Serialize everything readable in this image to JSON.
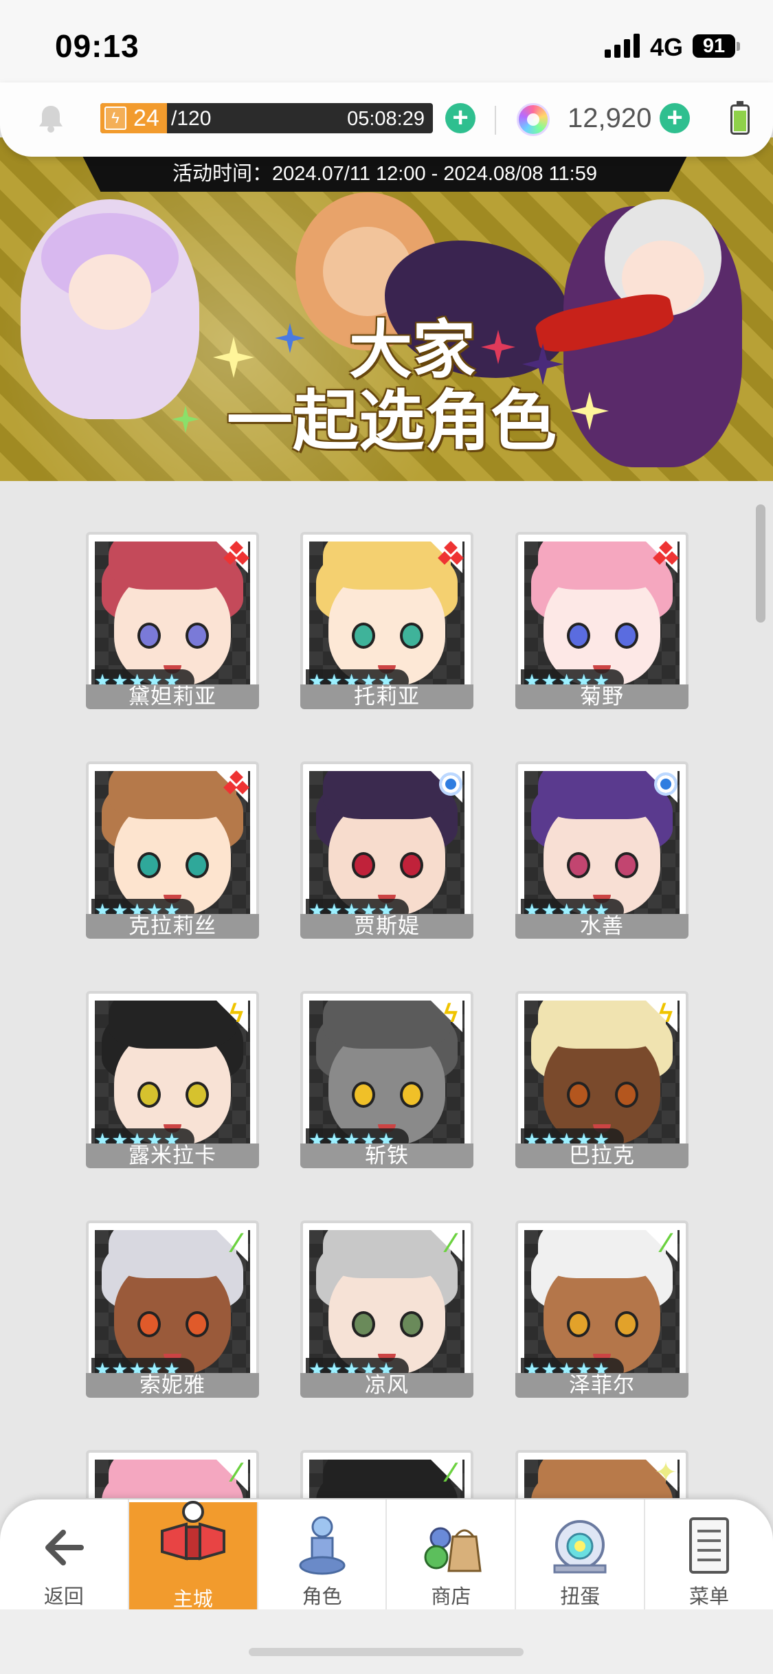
{
  "status_bar": {
    "time": "09:13",
    "network": "4G",
    "battery": "91"
  },
  "resources": {
    "stamina_current": "24",
    "stamina_max": "/120",
    "stamina_fraction": 0.2,
    "stamina_timer": "05:08:29",
    "gems": "12,920"
  },
  "banner": {
    "period": "活动时间：2024.07/11 12:00 - 2024.08/08 11:59",
    "title_line1": "大家",
    "title_line2": "一起选角色"
  },
  "characters": [
    {
      "name": "黛妲莉亚",
      "element": "fire",
      "stars": 5,
      "hair": "#c44a5a",
      "skin": "#fbe3d4",
      "eyes": "#7a7ad8"
    },
    {
      "name": "托莉亚",
      "element": "fire",
      "stars": 5,
      "hair": "#f4d070",
      "skin": "#fde8d6",
      "eyes": "#3fb39a"
    },
    {
      "name": "菊野",
      "element": "fire",
      "stars": 5,
      "hair": "#f5a7bf",
      "skin": "#fde8e6",
      "eyes": "#5a6ce0"
    },
    {
      "name": "克拉莉丝",
      "element": "fire",
      "stars": 5,
      "hair": "#b5794a",
      "skin": "#fde4cf",
      "eyes": "#2fa89a"
    },
    {
      "name": "贾斯媞",
      "element": "water",
      "stars": 5,
      "hair": "#3b2a4f",
      "skin": "#f7dccd",
      "eyes": "#c0223a"
    },
    {
      "name": "水善",
      "element": "water",
      "stars": 5,
      "hair": "#5a3a8e",
      "skin": "#f8dfd4",
      "eyes": "#c24570"
    },
    {
      "name": "露米拉卡",
      "element": "light",
      "stars": 5,
      "hair": "#232323",
      "skin": "#f8e2d5",
      "eyes": "#d6c22e"
    },
    {
      "name": "斩铁",
      "element": "light",
      "stars": 5,
      "hair": "#5b5b5b",
      "skin": "#8a8a8a",
      "eyes": "#f0c028"
    },
    {
      "name": "巴拉克",
      "element": "light",
      "stars": 5,
      "hair": "#f0e3b0",
      "skin": "#7a4a2c",
      "eyes": "#b4561e"
    },
    {
      "name": "索妮雅",
      "element": "wind",
      "stars": 5,
      "hair": "#d8d8e0",
      "skin": "#9a5a3a",
      "eyes": "#e05a2a"
    },
    {
      "name": "凉风",
      "element": "wind",
      "stars": 5,
      "hair": "#c8c8c8",
      "skin": "#f6e2d6",
      "eyes": "#6a8a5a"
    },
    {
      "name": "泽菲尔",
      "element": "wind",
      "stars": 5,
      "hair": "#f0f0f0",
      "skin": "#b4764a",
      "eyes": "#e2a22a"
    },
    {
      "name": "",
      "element": "wind",
      "stars": 5,
      "hair": "#f4a7c0",
      "skin": "#fde8e6",
      "eyes": "#5a6ce0"
    },
    {
      "name": "",
      "element": "wind",
      "stars": 5,
      "hair": "#222222",
      "skin": "#6a4a3a",
      "eyes": "#d6a020"
    },
    {
      "name": "",
      "element": "star",
      "stars": 5,
      "hair": "#b87a4a",
      "skin": "#f8dfcc",
      "eyes": "#7a5a3a"
    }
  ],
  "nav": [
    {
      "label": "返回",
      "icon": "back-arrow-icon"
    },
    {
      "label": "主城",
      "icon": "castle-icon"
    },
    {
      "label": "角色",
      "icon": "character-icon"
    },
    {
      "label": "商店",
      "icon": "shop-bag-icon"
    },
    {
      "label": "扭蛋",
      "icon": "gacha-machine-icon"
    },
    {
      "label": "菜单",
      "icon": "menu-list-icon"
    }
  ],
  "colors": {
    "accent": "#f29b2d",
    "plus": "#2fbf8f",
    "fire": "#e33333",
    "water": "#2f7de0",
    "light": "#f0c400",
    "wind": "#6cd240"
  }
}
